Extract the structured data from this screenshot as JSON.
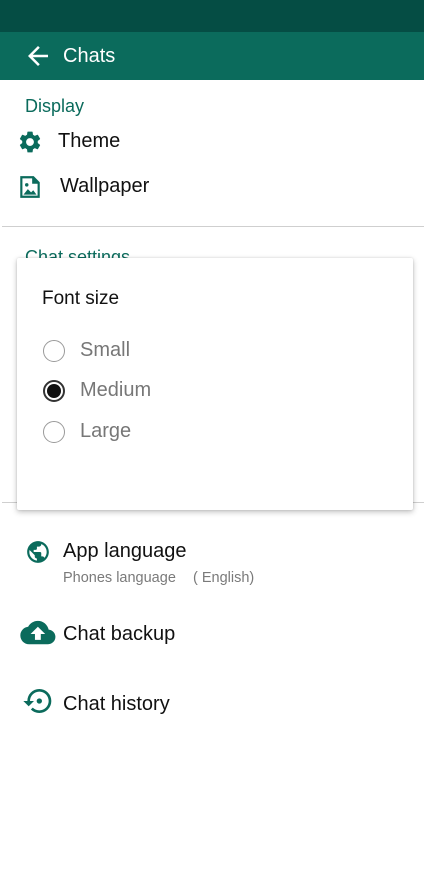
{
  "app_bar": {
    "title": "Chats",
    "back_icon": "arrow-left-icon"
  },
  "display": {
    "header": "Display",
    "items": [
      {
        "label": "Theme",
        "icon": "gear-icon"
      },
      {
        "label": "Wallpaper",
        "icon": "image-icon"
      }
    ]
  },
  "chat_settings": {
    "header": "Chat settings"
  },
  "dialog": {
    "title": "Font size",
    "options": [
      {
        "label": "Small",
        "checked": false
      },
      {
        "label": "Medium",
        "checked": true
      },
      {
        "label": "Large",
        "checked": false
      }
    ]
  },
  "app_language": {
    "label": "App language",
    "sub_label": "Phones language",
    "sub_value": "( English)",
    "icon": "globe-icon"
  },
  "chat_backup": {
    "label": "Chat backup",
    "icon": "cloud-upload-icon"
  },
  "chat_history": {
    "label": "Chat history",
    "icon": "history-icon"
  },
  "colors": {
    "primary": "#0b6b5c",
    "status_bar": "#054d44"
  }
}
